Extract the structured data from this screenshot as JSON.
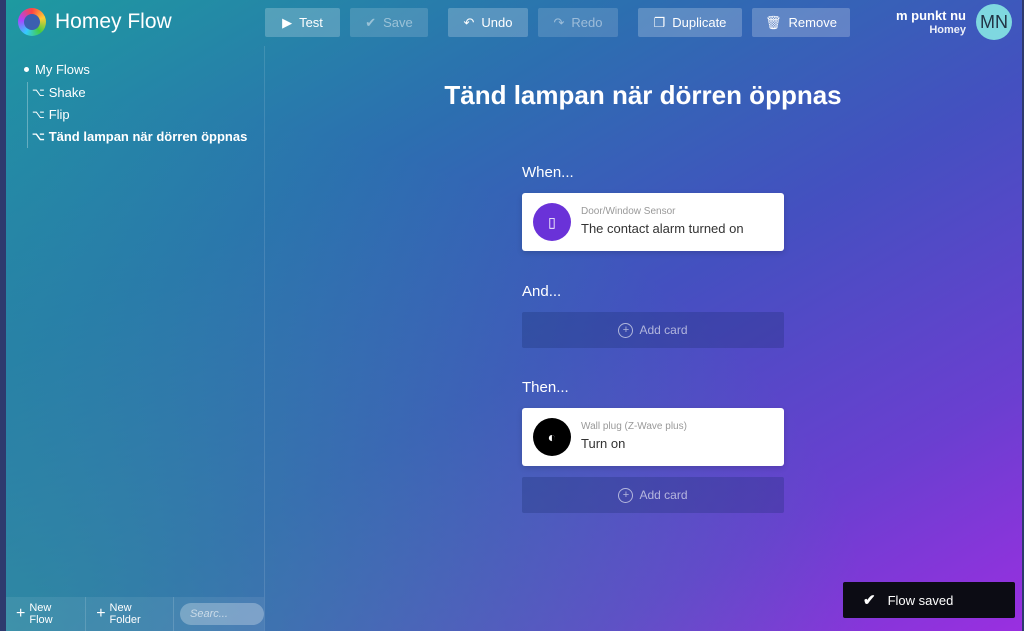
{
  "app": {
    "title": "Homey Flow"
  },
  "toolbar": {
    "test": "Test",
    "save": "Save",
    "undo": "Undo",
    "redo": "Redo",
    "duplicate": "Duplicate",
    "remove": "Remove"
  },
  "user": {
    "name": "m punkt nu",
    "home": "Homey",
    "initials": "MN"
  },
  "sidebar": {
    "root": "My Flows",
    "items": [
      {
        "label": "Shake"
      },
      {
        "label": "Flip"
      },
      {
        "label": "Tänd lampan när dörren öppnas"
      }
    ],
    "new_flow": "New Flow",
    "new_folder": "New Folder",
    "search_placeholder": "Searc..."
  },
  "flow": {
    "title": "Tänd lampan när dörren öppnas",
    "when_label": "When...",
    "and_label": "And...",
    "then_label": "Then...",
    "when_card": {
      "device": "Door/Window Sensor",
      "action": "The contact alarm turned on"
    },
    "then_card": {
      "device": "Wall plug (Z-Wave plus)",
      "action": "Turn on"
    },
    "add_card": "Add card"
  },
  "toast": {
    "message": "Flow saved"
  },
  "colors": {
    "purple_icon": "#6a32d8",
    "toast_bg": "#0c0c14"
  }
}
